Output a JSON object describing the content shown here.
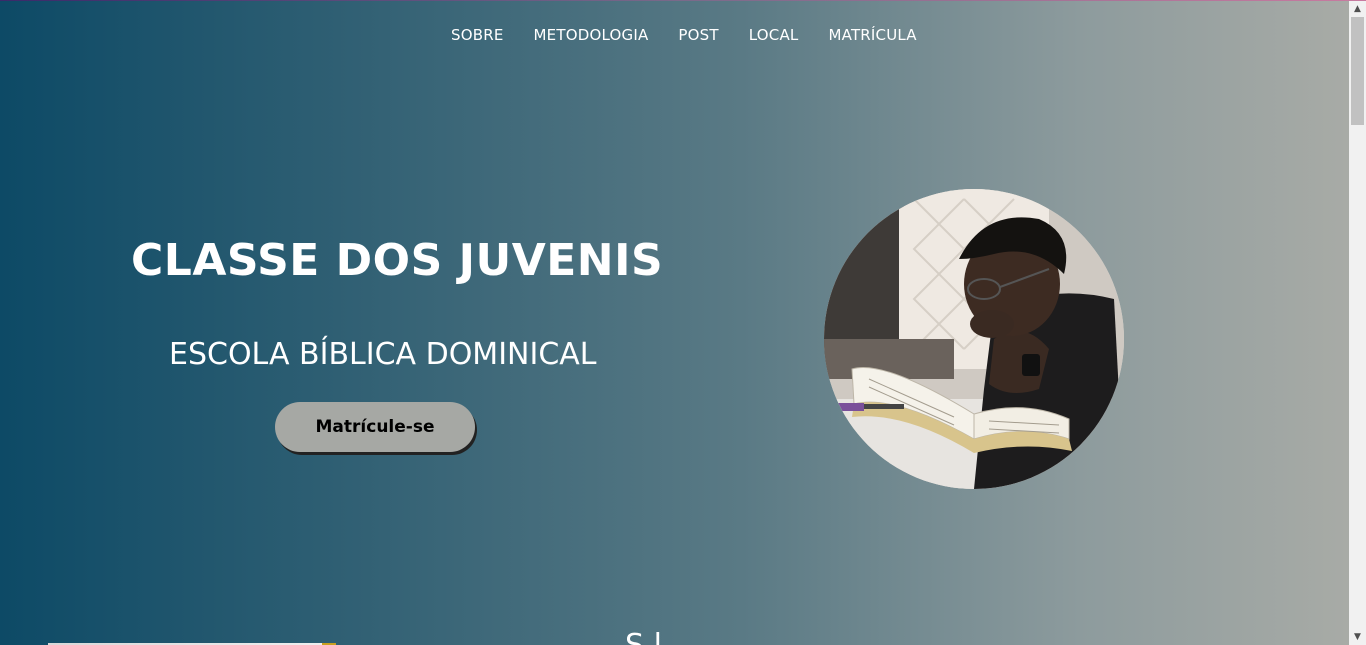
{
  "nav": {
    "items": [
      {
        "label": "SOBRE"
      },
      {
        "label": "METODOLOGIA"
      },
      {
        "label": "POST"
      },
      {
        "label": "LOCAL"
      },
      {
        "label": "MATRÍCULA"
      }
    ]
  },
  "hero": {
    "title": "CLASSE DOS JUVENIS",
    "subtitle": "ESCOLA BÍBLICA DOMINICAL",
    "cta_label": "Matrícule-se",
    "photo_alt": "Jovem lendo a Bíblia"
  },
  "next_section": {
    "heading_partial": "S  l"
  },
  "scrollbar": {
    "up_icon": "▲",
    "down_icon": "▼"
  },
  "colors": {
    "gradient_start": "#0d4a66",
    "gradient_end": "#a8aba6",
    "button_bg": "#a6a8a4"
  }
}
